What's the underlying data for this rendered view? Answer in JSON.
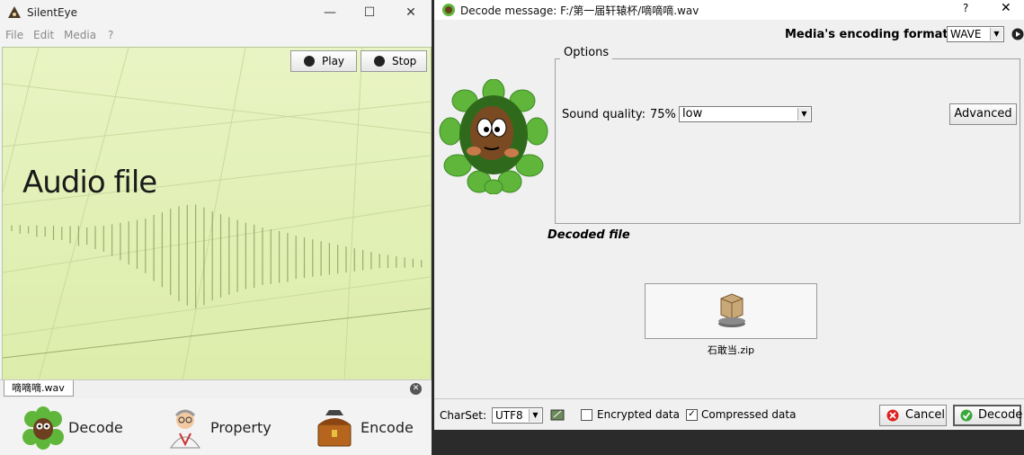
{
  "left_window": {
    "title": "SilentEye",
    "menu": [
      "File",
      "Edit",
      "Media",
      "?"
    ],
    "play_label": "Play",
    "stop_label": "Stop",
    "audio_label": "Audio file",
    "tab_label": "嘀嘀嘀.wav",
    "actions": {
      "decode": "Decode",
      "property": "Property",
      "encode": "Encode"
    },
    "icons": {
      "minimize": "minimize-icon",
      "maximize": "maximize-icon",
      "close": "close-icon"
    }
  },
  "right_window": {
    "title": "Decode message: F:/第一届轩辕杯/嘀嘀嘀.wav",
    "help": "?",
    "close": "✕",
    "encoding_label": "Media's encoding format :",
    "encoding_value": "WAVE",
    "options_title": "Options",
    "sound_quality_label": "Sound quality:",
    "sound_quality_value": "75%",
    "sound_quality_option": "low",
    "advanced_label": "Advanced",
    "decoded_file_label": "Decoded file",
    "decoded_file_name": "石敢当.zip",
    "charset_label": "CharSet:",
    "charset_value": "UTF8",
    "encrypted_label": "Encrypted data",
    "encrypted_checked": false,
    "compressed_label": "Compressed data",
    "compressed_checked": true,
    "cancel_label": "Cancel",
    "decode_label": "Decode"
  },
  "colors": {
    "audio_bg": "#e2f0b6",
    "wave": "#8ba45c",
    "leaf": "#5fb63a"
  }
}
